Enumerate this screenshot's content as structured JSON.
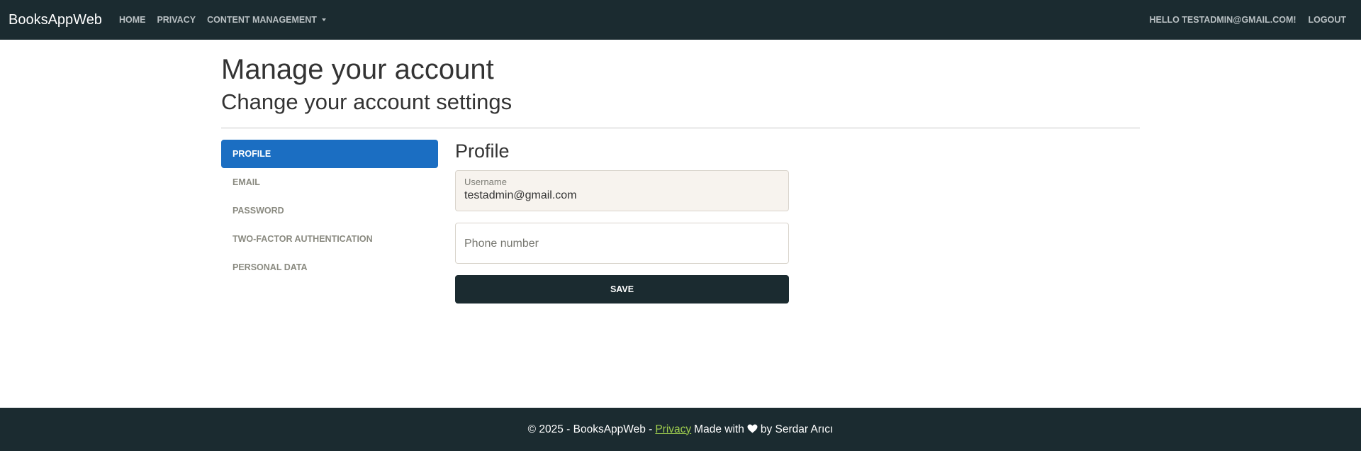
{
  "navbar": {
    "brand": "BooksAppWeb",
    "links": [
      "Home",
      "Privacy",
      "Content Management"
    ],
    "greeting": "Hello testadmin@gmail.com!",
    "logout": "Logout",
    "background": "#1b2b30"
  },
  "page": {
    "title": "Manage your account",
    "subtitle": "Change your account settings"
  },
  "sidebar": {
    "items": [
      {
        "label": "Profile",
        "active": true
      },
      {
        "label": "Email",
        "active": false
      },
      {
        "label": "Password",
        "active": false
      },
      {
        "label": "Two-factor authentication",
        "active": false
      },
      {
        "label": "Personal data",
        "active": false
      }
    ],
    "active_color": "#1b6ec2"
  },
  "profile": {
    "title": "Profile",
    "username_label": "Username",
    "username_value": "testadmin@gmail.com",
    "phone_placeholder": "Phone number",
    "save_label": "Save"
  },
  "footer": {
    "copyright": "© 2025 - BooksAppWeb -",
    "privacy_link": "Privacy",
    "made_with": "Made with",
    "heart_icon": "heart-icon",
    "by": "by Serdar Arıcı",
    "link_color": "#9fce4e"
  }
}
